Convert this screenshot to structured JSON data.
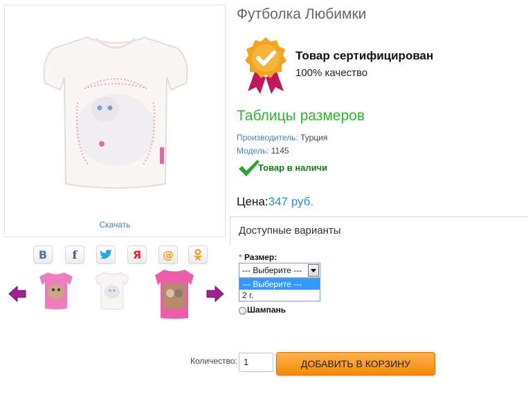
{
  "product": {
    "title": "Футболка Любимки",
    "download_label": "Скачать"
  },
  "certificate": {
    "title": "Товар сертифицирован",
    "subtitle": "100% качество",
    "icon": "checkmark-badge-icon",
    "badge_color": "#f3a51f",
    "ribbon_color": "#c2185b"
  },
  "sizes_link": "Таблицы размеров",
  "meta": {
    "manufacturer_label": "Производитель:",
    "manufacturer_value": "Турция",
    "model_label": "Модель:",
    "model_value": "1145"
  },
  "stock": {
    "text": "Товар в наличи",
    "icon": "checkmark-icon"
  },
  "price": {
    "label": "Цена:",
    "value": "347 руб."
  },
  "variants": {
    "heading": "Доступные варианты",
    "size_required_mark": "*",
    "size_label": "Размер:",
    "select_value": "--- Выберите ---",
    "options": [
      "--- Выберите ---",
      "2 г."
    ],
    "radio_label": "Шампань"
  },
  "quantity": {
    "label": "Количество:",
    "value": "1"
  },
  "add_to_cart": "ДОБАВИТЬ В КОРЗИНУ",
  "social": [
    {
      "name": "vkontakte",
      "glyph": "В",
      "color": "#4c75a3"
    },
    {
      "name": "facebook",
      "glyph": "f",
      "color": "#3b5998"
    },
    {
      "name": "twitter",
      "glyph": "t",
      "color": "#29a9e1"
    },
    {
      "name": "moi-krug",
      "glyph": "Я",
      "color": "#e02828"
    },
    {
      "name": "mail",
      "glyph": "@",
      "color": "#f39a12"
    },
    {
      "name": "odnoklassniki",
      "glyph": "ок",
      "color": "#f39a12"
    }
  ],
  "colors": {
    "accent_green": "#2fb52f",
    "link_blue": "#3a87ad",
    "price_blue": "#2a8fc9",
    "button_orange": "#f79a22",
    "arrow_purple": "#a0208f"
  }
}
